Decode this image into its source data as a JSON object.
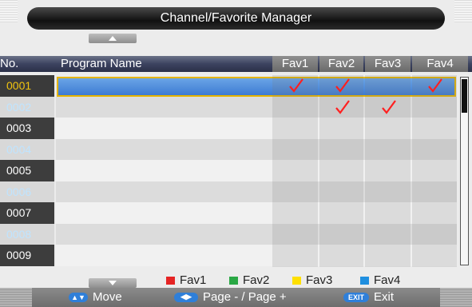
{
  "title": "Channel/Favorite Manager",
  "headers": {
    "no": "No.",
    "program_name": "Program Name",
    "fav1": "Fav1",
    "fav2": "Fav2",
    "fav3": "Fav3",
    "fav4": "Fav4"
  },
  "rows": [
    {
      "no": "0001",
      "fav": [
        true,
        true,
        false,
        true
      ]
    },
    {
      "no": "0002",
      "fav": [
        false,
        true,
        true,
        false
      ]
    },
    {
      "no": "0003",
      "fav": [
        false,
        false,
        false,
        false
      ]
    },
    {
      "no": "0004",
      "fav": [
        false,
        false,
        false,
        false
      ]
    },
    {
      "no": "0005",
      "fav": [
        false,
        false,
        false,
        false
      ]
    },
    {
      "no": "0006",
      "fav": [
        false,
        false,
        false,
        false
      ]
    },
    {
      "no": "0007",
      "fav": [
        false,
        false,
        false,
        false
      ]
    },
    {
      "no": "0008",
      "fav": [
        false,
        false,
        false,
        false
      ]
    },
    {
      "no": "0009",
      "fav": [
        false,
        false,
        false,
        false
      ]
    }
  ],
  "legend": [
    {
      "label": "Fav1",
      "color": "#e52424"
    },
    {
      "label": "Fav2",
      "color": "#2aa845"
    },
    {
      "label": "Fav3",
      "color": "#ffe000"
    },
    {
      "label": "Fav4",
      "color": "#1f8fe0"
    }
  ],
  "footer": {
    "move": "Move",
    "page": "Page - / Page +",
    "exit": "Exit",
    "exit_key": "EXIT"
  },
  "colors": {
    "selected_row": "#4a87d8",
    "selected_border": "#e5b400",
    "check": "#ff2020"
  }
}
